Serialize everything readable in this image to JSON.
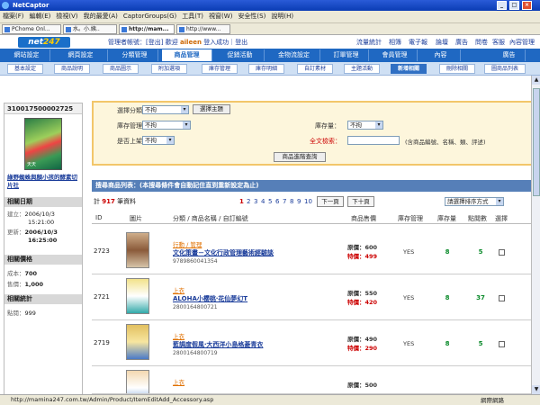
{
  "window": {
    "title": "NetCaptor",
    "minimize": "_",
    "maximize": "□",
    "close": "×"
  },
  "menu": {
    "items": [
      "檔案(F)",
      "編輯(E)",
      "檢視(V)",
      "我的最愛(A)",
      "CaptorGroups(G)",
      "工具(T)",
      "視窗(W)",
      "安全性(S)",
      "說明(H)"
    ]
  },
  "browser_tabs": [
    "PChome Onl...",
    "水。小.姨..",
    "http://mam...",
    "http://www..."
  ],
  "site_header": {
    "logo_main": "net",
    "logo_num": "247",
    "admin_label": "管理者帳號：[",
    "admin_link": "登出",
    "admin_close": "]",
    "welcome": "歡迎",
    "user": "aileen",
    "welcome_tail": "登入成功",
    "logout": "登出",
    "tools": [
      "流量統計",
      "相簿",
      "電子報",
      "論壇",
      "廣告",
      "問卷",
      "客服",
      "內容管理"
    ]
  },
  "main_nav": [
    "網站設定",
    "網頁設定",
    "分類管理",
    "商品管理",
    "促銷活動",
    "金物流設定",
    "訂單管理",
    "會員管理",
    "內容",
    "廣告"
  ],
  "main_nav_active": "商品管理",
  "sub_nav": [
    "基本設定",
    "商品說明",
    "商品圖示",
    "附加選項",
    "庫存管理",
    "庫存明細",
    "自訂素材",
    "主題活動",
    "新增相關",
    "刪除相關",
    "圖商品列表"
  ],
  "sub_nav_active": "新增相關",
  "sidebar": {
    "product_id": "310017500002725",
    "cover_text": "天天",
    "title": "綠野蜘蛛與顏小孩的酵素切片社",
    "section_date": "相關日期",
    "created_label": "建立：",
    "created_val": "2006/10/3",
    "created_time": "15:21:00",
    "updated_label": "更新：",
    "updated_val": "2006/10/3",
    "updated_time": "16:25:00",
    "section_price": "相關價格",
    "cost_label": "成本：",
    "cost_val": "700",
    "list_label": "售價：",
    "list_val": "1,000",
    "section_stats": "相關統計",
    "views_label": "點閱：",
    "views_val": "999"
  },
  "search": {
    "category_label": "選擇分類：",
    "category_value": "不拘",
    "select_subject_btn": "選擇主題",
    "stock_mgmt_label": "庫存管理：",
    "stock_mgmt_value": "不拘",
    "stock_qty_label": "庫存量：",
    "stock_qty_value": "不拘",
    "shelf_label": "是否上架：",
    "shelf_value": "不拘",
    "keyword_label": "全文檢索：",
    "keyword_value": "",
    "keyword_hint": "(含商品編號、名稱、類、評述)",
    "submit_btn": "商品進階查詢"
  },
  "list": {
    "header": "搜尋商品列表：(本搜尋條件會自動記住直到重新設定為止)",
    "total_prefix": "計",
    "total": "917",
    "total_suffix": "筆資料",
    "current_page": "1",
    "pages": [
      "2",
      "3",
      "4",
      "5",
      "6",
      "7",
      "8",
      "9",
      "10"
    ],
    "prev_btn": "下一頁",
    "next_btn": "下十頁",
    "sort_label": "請選擇排序方式",
    "columns": [
      "ID",
      "圖片",
      "分類 / 商品名稱 / 自訂編號",
      "商品售價",
      "庫存管理",
      "庫存量",
      "點閱數",
      "選擇"
    ]
  },
  "rows": [
    {
      "id": "2723",
      "category": "行動 / 管理",
      "name": "文化策畫－文化行政管理藝術經驗談",
      "isbn": "9789860041354",
      "list_label": "原價：",
      "list_price": "600",
      "special_label": "特價：",
      "special_price": "499",
      "stock": "YES",
      "qty": "8",
      "clicks": "5",
      "thumb_colors": [
        "#cfae8a",
        "#8a5a3a",
        "#d6c4a8"
      ]
    },
    {
      "id": "2721",
      "category": "上衣",
      "name": "ALOHA小櫻桃‧花仙夢幻T",
      "isbn": "2800164800721",
      "list_label": "原價：",
      "list_price": "550",
      "special_label": "特價：",
      "special_price": "420",
      "stock": "YES",
      "qty": "8",
      "clicks": "37",
      "thumb_colors": [
        "#f2e28a",
        "#fff",
        "#3aa"
      ]
    },
    {
      "id": "2719",
      "category": "上衣",
      "name": "藍調度假風‧大西洋小島格菱青衣",
      "isbn": "2800164800719",
      "list_label": "原價：",
      "list_price": "490",
      "special_label": "特價：",
      "special_price": "290",
      "stock": "YES",
      "qty": "8",
      "clicks": "5",
      "thumb_colors": [
        "#e2c060",
        "#f7e6a0",
        "#4a7ac8"
      ]
    },
    {
      "id": "",
      "category": "上衣",
      "name": "",
      "isbn": "",
      "list_label": "原價：",
      "list_price": "500",
      "special_label": "",
      "special_price": "",
      "stock": "",
      "qty": "",
      "clicks": "",
      "thumb_colors": [
        "#f3d8b0",
        "#fff",
        "#6a9ad6"
      ]
    }
  ],
  "statusbar": {
    "url": "http://mamina247.com.tw/Admin/Product/ItemEditAdd_Accessory.asp",
    "zone": "網際網路"
  }
}
